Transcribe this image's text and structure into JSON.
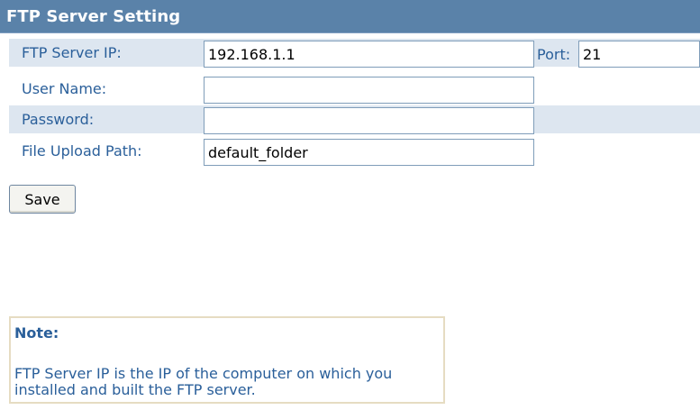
{
  "header": {
    "title": "FTP Server Setting"
  },
  "form": {
    "server_ip": {
      "label": "FTP Server IP:",
      "value": "192.168.1.1"
    },
    "port": {
      "label": "Port:",
      "value": "21"
    },
    "user_name": {
      "label": "User Name:",
      "value": ""
    },
    "password": {
      "label": "Password:",
      "value": ""
    },
    "upload_path": {
      "label": "File Upload Path:",
      "value": "default_folder"
    }
  },
  "actions": {
    "save_label": "Save"
  },
  "note": {
    "title": "Note:",
    "text": "FTP Server IP is the IP of the computer on which you installed and built the FTP server."
  }
}
